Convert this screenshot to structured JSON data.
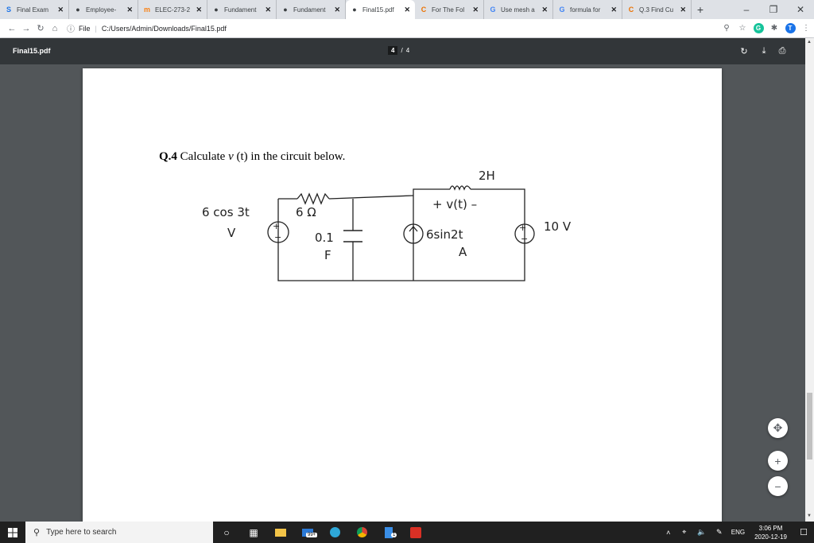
{
  "browser": {
    "tabs": [
      {
        "title": "Final Exam",
        "icon": "s-letter-icon",
        "active": false
      },
      {
        "title": "Employee-",
        "icon": "globe-icon",
        "active": false
      },
      {
        "title": "ELEC-273-2",
        "icon": "moodle-icon",
        "active": false
      },
      {
        "title": "Fundament",
        "icon": "globe-icon",
        "active": false
      },
      {
        "title": "Fundament",
        "icon": "globe-icon",
        "active": false
      },
      {
        "title": "Final15.pdf",
        "icon": "globe-icon",
        "active": true
      },
      {
        "title": "For The Fol",
        "icon": "chegg-icon",
        "active": false
      },
      {
        "title": "Use mesh a",
        "icon": "google-icon",
        "active": false
      },
      {
        "title": "formula for",
        "icon": "google-icon",
        "active": false
      },
      {
        "title": "Q.3 Find Cu",
        "icon": "chegg-icon",
        "active": false
      }
    ],
    "new_tab": "+",
    "address": {
      "scheme_label": "File",
      "url": "C:/Users/Admin/Downloads/Final15.pdf"
    },
    "profile_initial": "T"
  },
  "pdf": {
    "title": "Final15.pdf",
    "current_page": "4",
    "separator": "/",
    "total_pages": "4",
    "question_number": "Q.4",
    "question_text": "Calculate",
    "question_var": "v",
    "question_arg": "(t)",
    "question_tail": "in the circuit below."
  },
  "circuit": {
    "labels": {
      "v_source": "6 cos 3t",
      "v_unit": "V",
      "resistor": "6 Ω",
      "capacitor": "0.1",
      "cap_unit": "F",
      "inductor": "2H",
      "v_t": "+ v(t) –",
      "i_source": "6sin2t",
      "i_unit": "A",
      "dc_source": "10 V"
    }
  },
  "viewer": {
    "zoom_fit": "fit-page-icon",
    "zoom_in": "+",
    "zoom_out": "−"
  },
  "taskbar": {
    "search_placeholder": "Type here to search",
    "mail_badge": "99+",
    "acrobat_badge": "1",
    "language": "ENG",
    "time": "3:06 PM",
    "date": "2020-12-19"
  }
}
